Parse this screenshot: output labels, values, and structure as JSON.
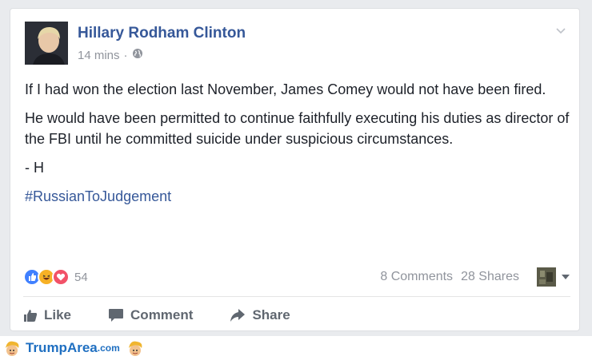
{
  "post": {
    "author": "Hillary Rodham Clinton",
    "timestamp": "14 mins",
    "separator": "·",
    "privacy_icon": "globe-icon",
    "paragraphs": [
      "If I had won the election last November, James Comey would not have been fired.",
      "He would have been permitted to continue faithfully executing his duties as director of the FBI until he committed suicide under suspicious circumstances.",
      "- H"
    ],
    "hashtag": "#RussianToJudgement"
  },
  "stats": {
    "reactions": [
      "like",
      "haha",
      "love"
    ],
    "reaction_count": "54",
    "comments": "8 Comments",
    "shares": "28 Shares"
  },
  "actions": {
    "like": "Like",
    "comment": "Comment",
    "share": "Share"
  },
  "footer": {
    "logo_text": "TrumpArea",
    "logo_suffix": ".com"
  },
  "colors": {
    "link": "#365899",
    "meta": "#90949c",
    "like_blue": "#4080ff",
    "love_red": "#f25268",
    "haha_yellow": "#f7b125"
  }
}
